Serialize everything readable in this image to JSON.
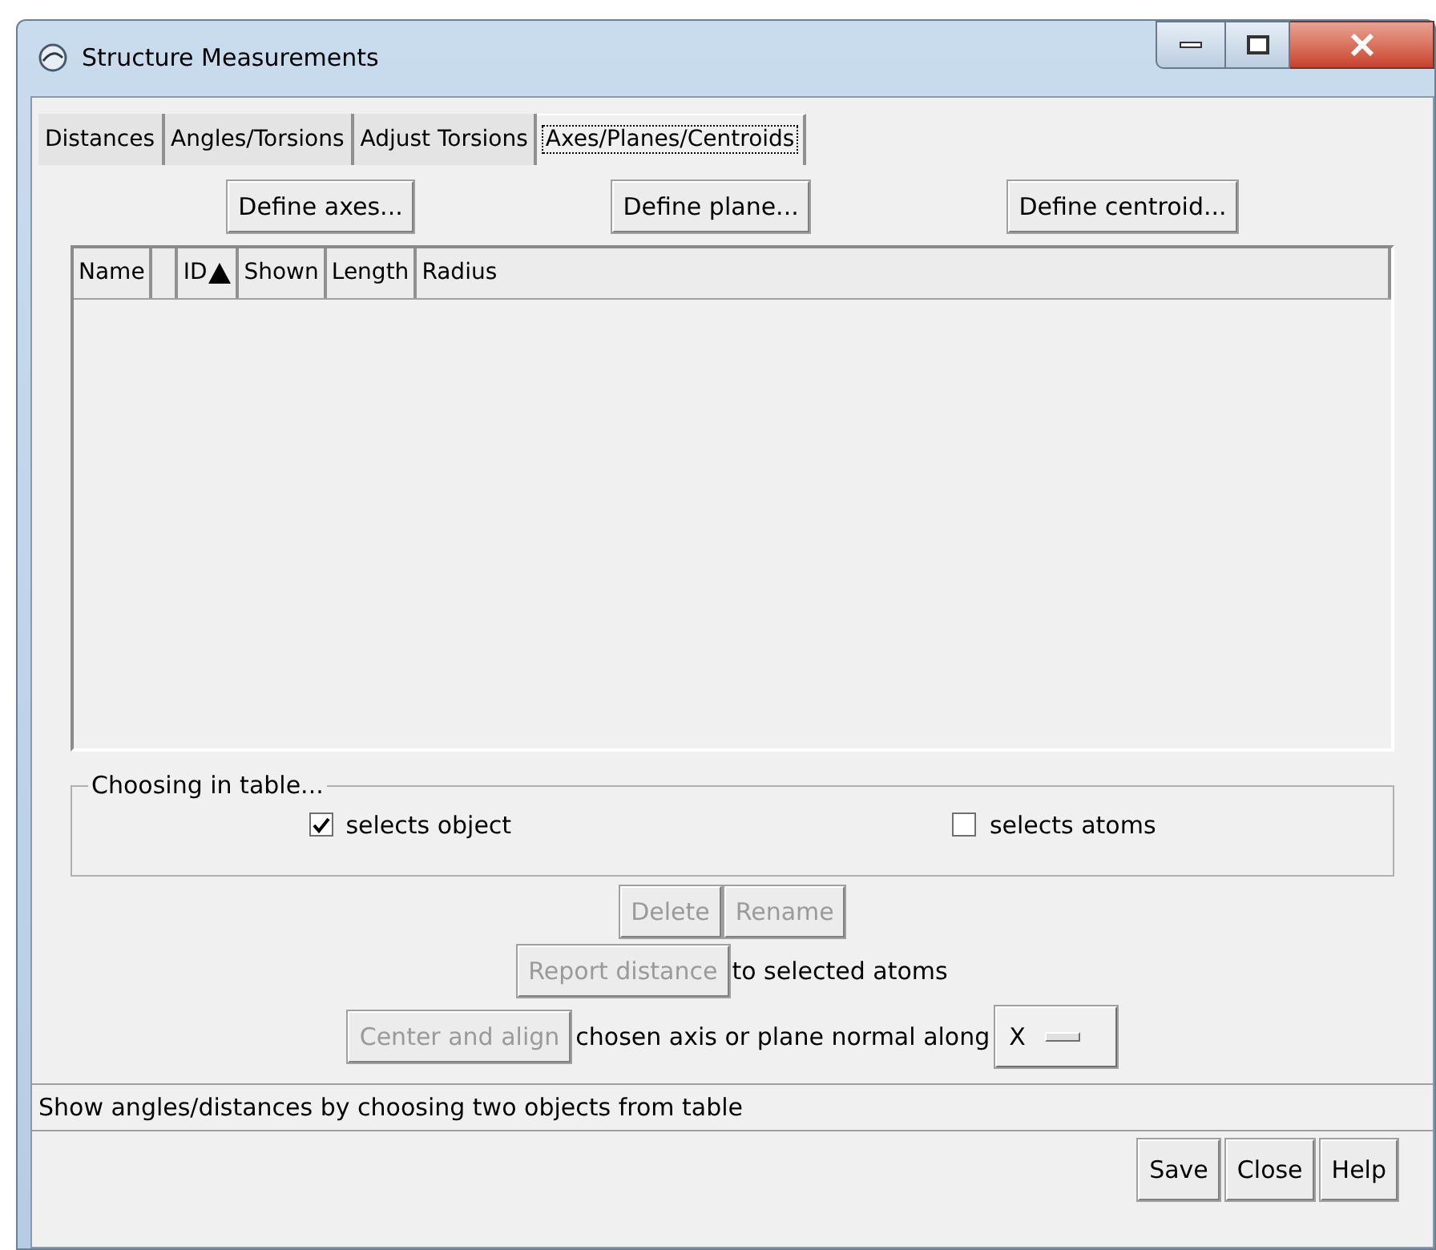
{
  "window": {
    "title": "Structure Measurements"
  },
  "tabs": [
    {
      "label": "Distances",
      "selected": false
    },
    {
      "label": "Angles/Torsions",
      "selected": false
    },
    {
      "label": "Adjust Torsions",
      "selected": false
    },
    {
      "label": "Axes/Planes/Centroids",
      "selected": true
    }
  ],
  "define_buttons": [
    "Define axes...",
    "Define plane...",
    "Define centroid..."
  ],
  "table": {
    "columns": [
      {
        "label": "Name",
        "sorted": false
      },
      {
        "sorted": false
      },
      {
        "label": "ID",
        "sorted": true
      },
      {
        "label": "Shown",
        "sorted": false
      },
      {
        "label": "Length",
        "sorted": false
      },
      {
        "label": "Radius",
        "sorted": false
      }
    ]
  },
  "choosing": {
    "title": "Choosing in table...",
    "options": [
      {
        "label": "selects object",
        "checked": true
      },
      {
        "label": "selects atoms",
        "checked": false
      }
    ]
  },
  "edit_buttons": [
    {
      "label": "Delete",
      "disabled": true
    },
    {
      "label": "Rename",
      "disabled": true
    }
  ],
  "report": {
    "button": {
      "label": "Report distance",
      "disabled": true
    },
    "text": "to selected atoms"
  },
  "center": {
    "button": {
      "label": "Center and align",
      "disabled": true
    },
    "text": "chosen axis or plane normal along",
    "menu_value": "X"
  },
  "status_bar": "Show angles/distances by choosing two objects from table",
  "footer_buttons": [
    "Save",
    "Close",
    "Help"
  ]
}
